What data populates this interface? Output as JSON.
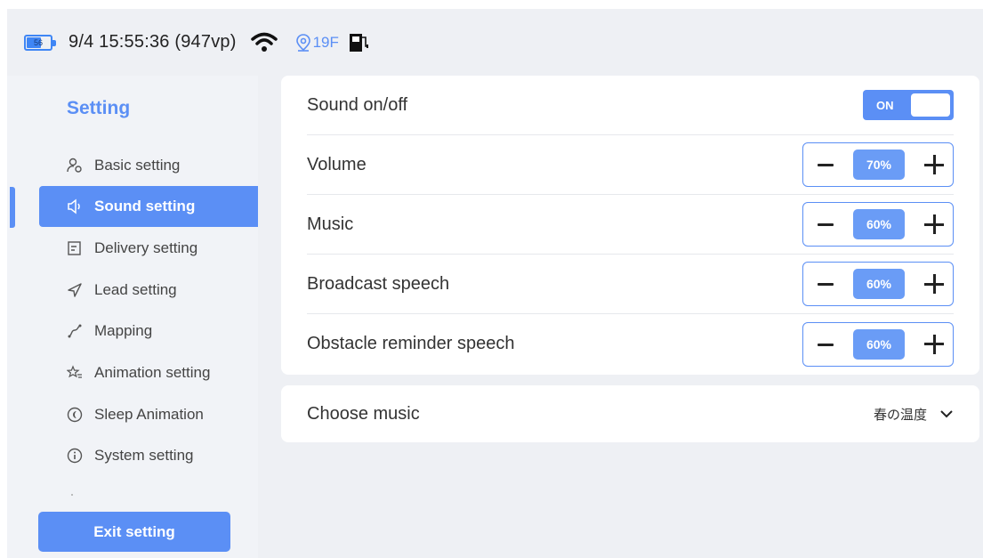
{
  "status_bar": {
    "battery_level": "56",
    "datetime": "9/4 15:55:36 (947vp)",
    "floor": "19F",
    "accent_color": "#5b8ff5"
  },
  "sidebar": {
    "title": "Setting",
    "items": [
      {
        "label": "Basic setting",
        "icon": "user-gear-icon",
        "active": false
      },
      {
        "label": "Sound setting",
        "icon": "speaker-icon",
        "active": true
      },
      {
        "label": "Delivery setting",
        "icon": "edit-note-icon",
        "active": false
      },
      {
        "label": "Lead setting",
        "icon": "send-icon",
        "active": false
      },
      {
        "label": "Mapping",
        "icon": "map-path-icon",
        "active": false
      },
      {
        "label": "Animation setting",
        "icon": "star-list-icon",
        "active": false
      },
      {
        "label": "Sleep Animation",
        "icon": "moon-circle-icon",
        "active": false
      },
      {
        "label": "System setting",
        "icon": "info-icon",
        "active": false
      }
    ],
    "exit_label": "Exit setting"
  },
  "sound_card": {
    "sound_toggle": {
      "label": "Sound on/off",
      "state": "ON"
    },
    "rows": [
      {
        "label": "Volume",
        "value": "70%"
      },
      {
        "label": "Music",
        "value": "60%"
      },
      {
        "label": "Broadcast speech",
        "value": "60%"
      },
      {
        "label": "Obstacle reminder speech",
        "value": "60%"
      }
    ]
  },
  "music_card": {
    "label": "Choose music",
    "selected": "春の温度"
  }
}
